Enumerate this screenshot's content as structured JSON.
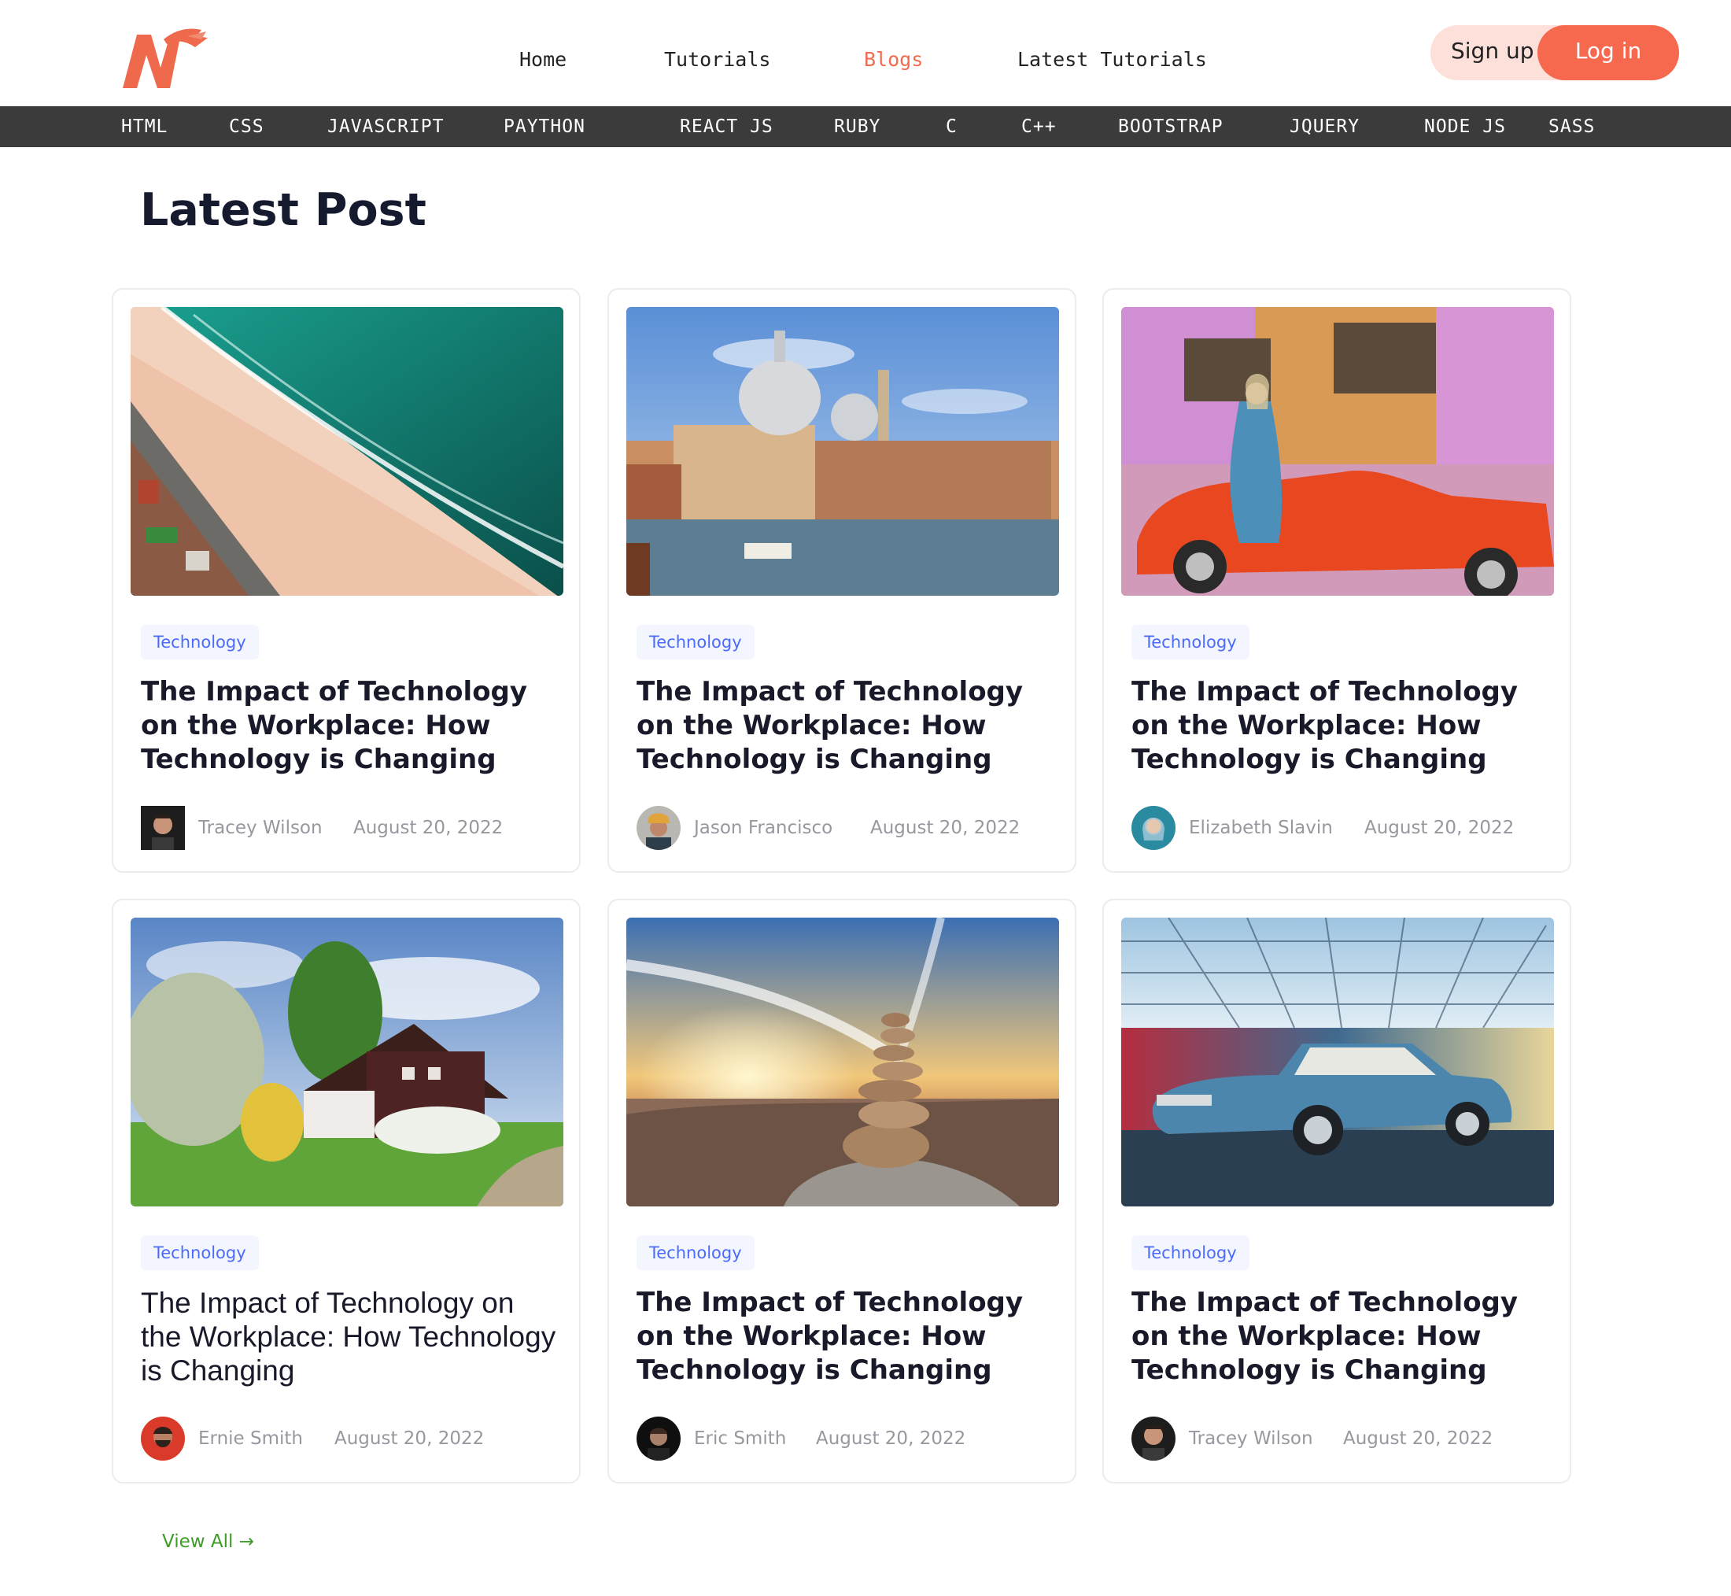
{
  "header": {
    "logo_icon": "brand-logo-icon",
    "nav": [
      {
        "label": "Home",
        "active": false
      },
      {
        "label": "Tutorials",
        "active": false
      },
      {
        "label": "Blogs",
        "active": true
      },
      {
        "label": "Latest Tutorials",
        "active": false
      }
    ],
    "signup_label": "Sign up",
    "login_label": "Log in"
  },
  "categories": [
    "HTML",
    "CSS",
    "JAVASCRIPT",
    "PAYTHON",
    "REACT JS",
    "RUBY",
    "C",
    "C++",
    "BOOTSTRAP",
    "JQUERY",
    "NODE JS",
    "SASS"
  ],
  "section": {
    "title": "Latest Post"
  },
  "posts": [
    {
      "tag": "Technology",
      "title": "The Impact of Technology on the Workplace: How Technology is Changing",
      "author": "Tracey Wilson",
      "date": "August 20, 2022",
      "image": "beach-aerial-photo"
    },
    {
      "tag": "Technology",
      "title": "The Impact of Technology on the Workplace: How Technology is Changing",
      "author": "Jason Francisco",
      "date": "August 20, 2022",
      "image": "venice-canal-photo"
    },
    {
      "tag": "Technology",
      "title": "The Impact of Technology on the Workplace: How Technology is Changing",
      "author": "Elizabeth Slavin",
      "date": "August 20, 2022",
      "image": "woman-orange-car-photo"
    },
    {
      "tag": "Technology",
      "title": "The Impact of Technology on the Workplace: How Technology is Changing",
      "author": "Ernie Smith",
      "date": "August 20, 2022",
      "image": "countryside-house-photo"
    },
    {
      "tag": "Technology",
      "title": "The Impact of Technology on the Workplace: How Technology is Changing",
      "author": "Eric Smith",
      "date": "August 20, 2022",
      "image": "stone-cairn-sunset-photo"
    },
    {
      "tag": "Technology",
      "title": "The Impact of Technology on the Workplace: How Technology is Changing",
      "author": "Tracey Wilson",
      "date": "August 20, 2022",
      "image": "vintage-blue-car-photo"
    }
  ],
  "view_all": {
    "label": "View All →"
  },
  "colors": {
    "accent": "#f7694e",
    "nav_bar": "#3b3b3b",
    "tag_text": "#4b6bfb",
    "link_green": "#3f9b2a"
  }
}
